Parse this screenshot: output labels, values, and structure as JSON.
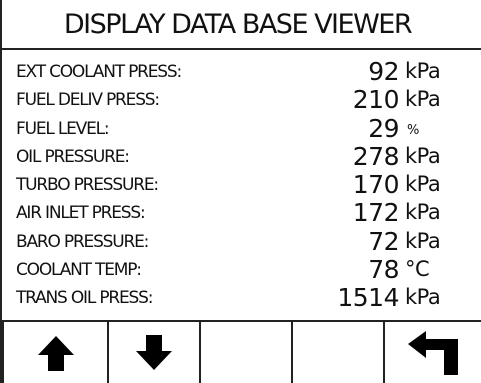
{
  "title": "DISPLAY DATA BASE VIEWER",
  "rows": [
    {
      "label": "EXT COOLANT PRESS:",
      "value": "92",
      "unit": "kPa"
    },
    {
      "label": "FUEL DELIV PRESS:",
      "value": "210",
      "unit": "kPa"
    },
    {
      "label": "FUEL LEVEL:",
      "value": "29",
      "unit": "%"
    },
    {
      "label": "OIL PRESSURE:",
      "value": "278",
      "unit": "kPa"
    },
    {
      "label": "TURBO PRESSURE:",
      "value": "170",
      "unit": "kPa"
    },
    {
      "label": "AIR INLET PRESS:",
      "value": "172",
      "unit": "kPa"
    },
    {
      "label": "BARO PRESSURE:",
      "value": "72",
      "unit": "kPa"
    },
    {
      "label": "COOLANT TEMP:",
      "value": "78",
      "unit": "°C"
    },
    {
      "label": "TRANS OIL PRESS:",
      "value": "1514",
      "unit": "kPa"
    }
  ],
  "buttons": [
    {
      "icon": "arrow-up-icon"
    },
    {
      "icon": "arrow-down-icon"
    },
    {
      "icon": ""
    },
    {
      "icon": ""
    },
    {
      "icon": "return-arrow-icon"
    }
  ]
}
